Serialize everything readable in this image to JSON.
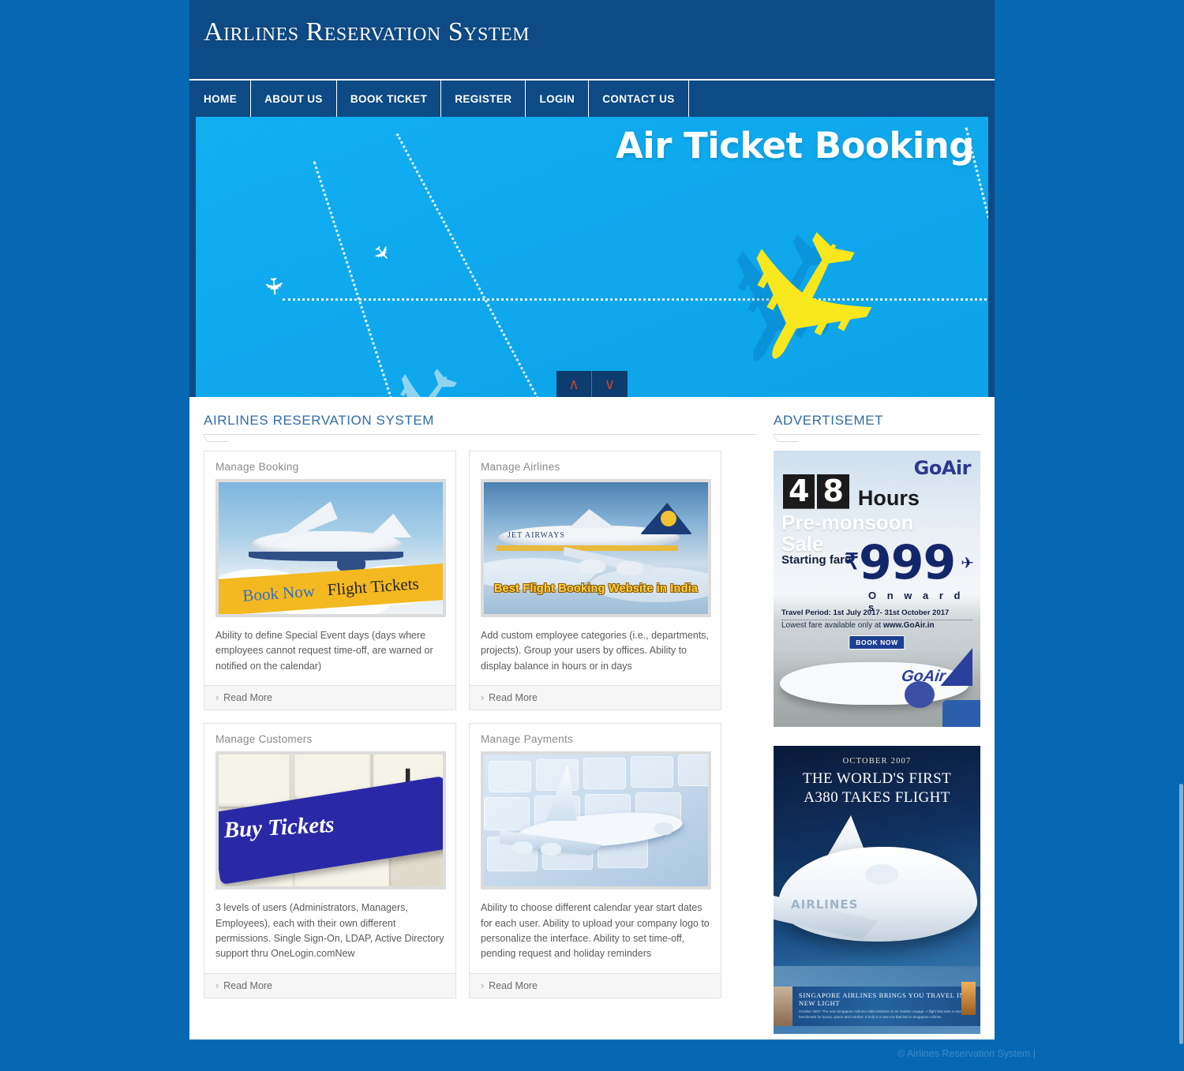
{
  "header": {
    "title": "Airlines Reservation System"
  },
  "nav": {
    "items": [
      {
        "label": "HOME"
      },
      {
        "label": "ABOUT US"
      },
      {
        "label": "BOOK TICKET"
      },
      {
        "label": "REGISTER"
      },
      {
        "label": "LOGIN"
      },
      {
        "label": "CONTACT US"
      }
    ]
  },
  "banner": {
    "headline": "Air Ticket Booking",
    "prev_label": "∧",
    "next_label": "∨"
  },
  "main": {
    "section_title": "AIRLINES RESERVATION SYSTEM",
    "cards": [
      {
        "title": "Manage Booking",
        "image_caption_left": "Book Now",
        "image_caption_right": "Flight Tickets",
        "description": "Ability to define Special Event days (days where employees cannot request time-off, are warned or notified on the calendar)",
        "read_more": "Read More"
      },
      {
        "title": "Manage Airlines",
        "image_caption": "Best Flight Booking Website in India",
        "airline_name": "JET AIRWAYS",
        "description": "Add custom employee categories (i.e., departments, projects). Group your users by offices. Ability to display balance in hours or in days",
        "read_more": "Read More"
      },
      {
        "title": "Manage Customers",
        "image_caption": "Buy Tickets",
        "description": "3 levels of users (Administrators, Managers, Employees), each with their own different permissions. Single Sign-On, LDAP, Active Directory support thru OneLogin.comNew",
        "read_more": "Read More"
      },
      {
        "title": "Manage Payments",
        "description": "Ability to choose different calendar year start dates for each user. Ability to upload your company logo to personalize the interface. Ability to set time-off, pending request and holiday reminders",
        "read_more": "Read More"
      }
    ]
  },
  "sidebar": {
    "section_title": "ADVERTISEMET",
    "ads": [
      {
        "brand": "GoAir",
        "hours_number": "48",
        "hours_label": "Hours",
        "sale_line1": "Pre-monsoon",
        "sale_line2": "Sale",
        "starting_fare_label": "Starting fare",
        "currency": "₹",
        "price": "999",
        "onwards": "O n w a r d s",
        "travel_period_label": "Travel Period:",
        "travel_period_value": "1st July 2017- 31st October 2017",
        "lowest_fare_text": "Lowest fare available only at",
        "website": "www.GoAir.in",
        "cta": "BOOK NOW",
        "plane_livery": "GoAir"
      },
      {
        "date": "OCTOBER 2007",
        "headline_line1": "THE WORLD'S FIRST",
        "headline_line2": "A380 TAKES FLIGHT",
        "livery": "AIRLINES",
        "strip_headline": "SINGAPORE AIRLINES BRINGS YOU TRAVEL IN A NEW LIGHT",
        "strip_body": "October 2007: The new Singapore Airlines A380 embarks on its maiden voyage. A flight that sets a new benchmark for luxury, space and comfort. It truly is a new era that lies in Singapore Airlines."
      }
    ]
  },
  "footer": {
    "copyright": "© Airlines Reservation System  |"
  },
  "colors": {
    "page_background": "#0668b3",
    "header_navy": "#0d4a86",
    "banner_blue": "#11aff0",
    "accent_yellow": "#f8e71c",
    "section_title": "#2f6ca5"
  }
}
